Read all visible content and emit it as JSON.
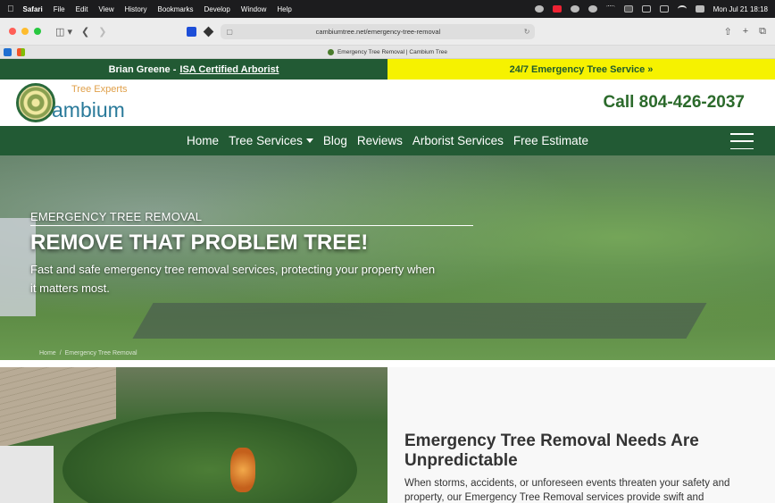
{
  "menubar": {
    "app": "Safari",
    "items": [
      "File",
      "Edit",
      "View",
      "History",
      "Bookmarks",
      "Develop",
      "Window",
      "Help"
    ],
    "datetime": "Mon Jul 21  18:18"
  },
  "browser": {
    "url": "cambiumtree.net/emergency-tree-removal",
    "tab_title": "Emergency Tree Removal | Cambium Tree"
  },
  "topbar": {
    "name": "Brian Greene - ",
    "cert_link": "ISA Certified Arborist",
    "service": "24/7 Emergency Tree Service »"
  },
  "header": {
    "logo_tagline": "Tree Experts",
    "logo_name": "ambium",
    "phone": "Call 804-426-2037"
  },
  "nav": {
    "items": [
      "Home",
      "Tree Services",
      "Blog",
      "Reviews",
      "Arborist Services",
      "Free Estimate"
    ]
  },
  "hero": {
    "kicker": "EMERGENCY TREE REMOVAL",
    "title": "REMOVE THAT PROBLEM TREE!",
    "description": "Fast and safe emergency tree removal services, protecting your property when it matters most.",
    "breadcrumb": [
      "Home",
      "Emergency Tree Removal"
    ]
  },
  "section": {
    "heading": "Emergency Tree Removal Needs Are Unpredictable",
    "body": "When storms, accidents, or unforeseen events threaten your safety and property, our Emergency Tree Removal services provide swift and"
  },
  "colors": {
    "brand_green": "#225a34",
    "accent_yellow": "#f6f200",
    "phone_green": "#2b6a2b"
  }
}
